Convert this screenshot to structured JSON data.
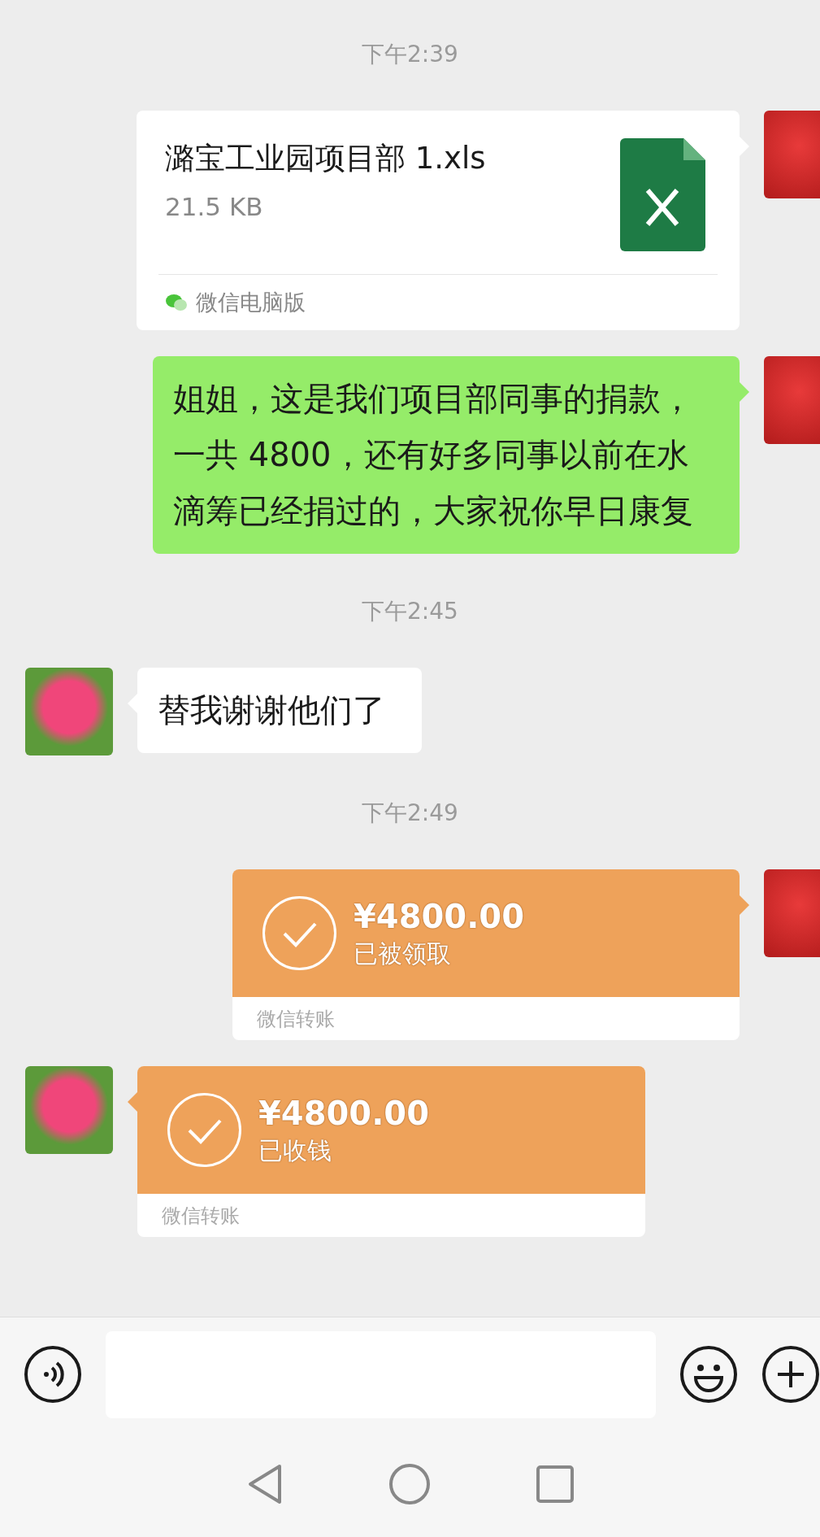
{
  "messages": [
    {
      "kind": "time",
      "text": "下午2:39"
    },
    {
      "kind": "file",
      "outgoing": true,
      "name": "潞宝工业园项目部 1.xls",
      "size": "21.5 KB",
      "source": "微信电脑版"
    },
    {
      "kind": "text",
      "outgoing": true,
      "text": "姐姐，这是我们项目部同事的捐款，一共 4800，还有好多同事以前在水滴筹已经捐过的，大家祝你早日康复"
    },
    {
      "kind": "time",
      "text": "下午2:45"
    },
    {
      "kind": "text",
      "outgoing": false,
      "text": "替我谢谢他们了"
    },
    {
      "kind": "time",
      "text": "下午2:49"
    },
    {
      "kind": "transfer",
      "outgoing": true,
      "amount": "¥4800.00",
      "status": "已被领取",
      "footer": "微信转账"
    },
    {
      "kind": "transfer",
      "outgoing": false,
      "amount": "¥4800.00",
      "status": "已收钱",
      "footer": "微信转账"
    }
  ]
}
